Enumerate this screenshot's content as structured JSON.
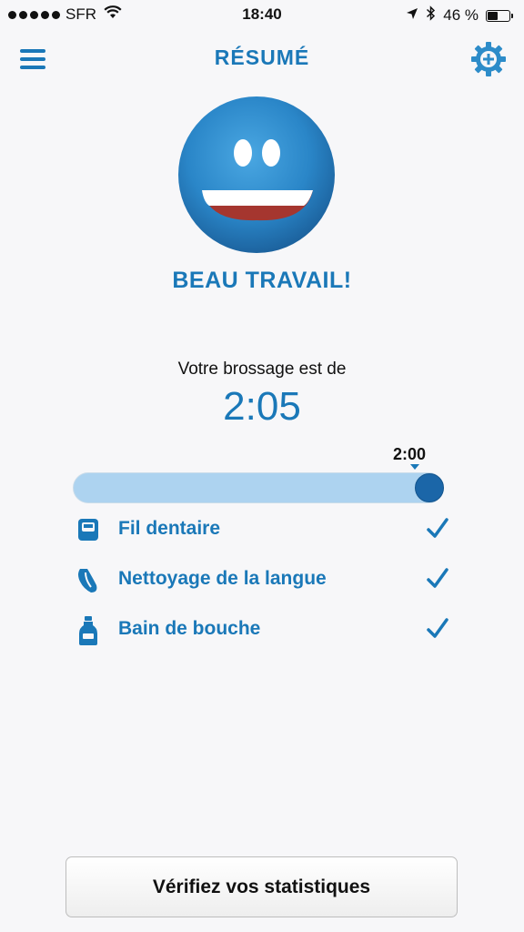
{
  "status_bar": {
    "carrier": "SFR",
    "time": "18:40",
    "battery_percent": "46 %",
    "battery_level": 0.46,
    "icons": [
      "signal-dots-icon",
      "wifi-icon",
      "location-arrow-icon",
      "bluetooth-icon",
      "battery-icon"
    ]
  },
  "header": {
    "title": "RÉSUMÉ",
    "menu_icon": "hamburger-menu-icon",
    "settings_icon": "gear-plus-icon"
  },
  "summary": {
    "face_icon": "smiley-face-icon",
    "headline": "BEAU TRAVAIL!",
    "brushing_label": "Votre brossage est de",
    "brushing_time": "2:05",
    "target_label": "2:00",
    "progress": 1.0
  },
  "checklist": [
    {
      "label": "Fil dentaire",
      "icon": "floss-icon",
      "checked": true
    },
    {
      "label": "Nettoyage de la langue",
      "icon": "tongue-icon",
      "checked": true
    },
    {
      "label": "Bain de bouche",
      "icon": "mouthwash-bottle-icon",
      "checked": true
    }
  ],
  "footer": {
    "stats_button_label": "Vérifiez vos statistiques"
  },
  "colors": {
    "accent": "#1a78b8",
    "progress_track": "#add3f0",
    "progress_knob": "#1b66a8",
    "background": "#f7f7f9"
  }
}
